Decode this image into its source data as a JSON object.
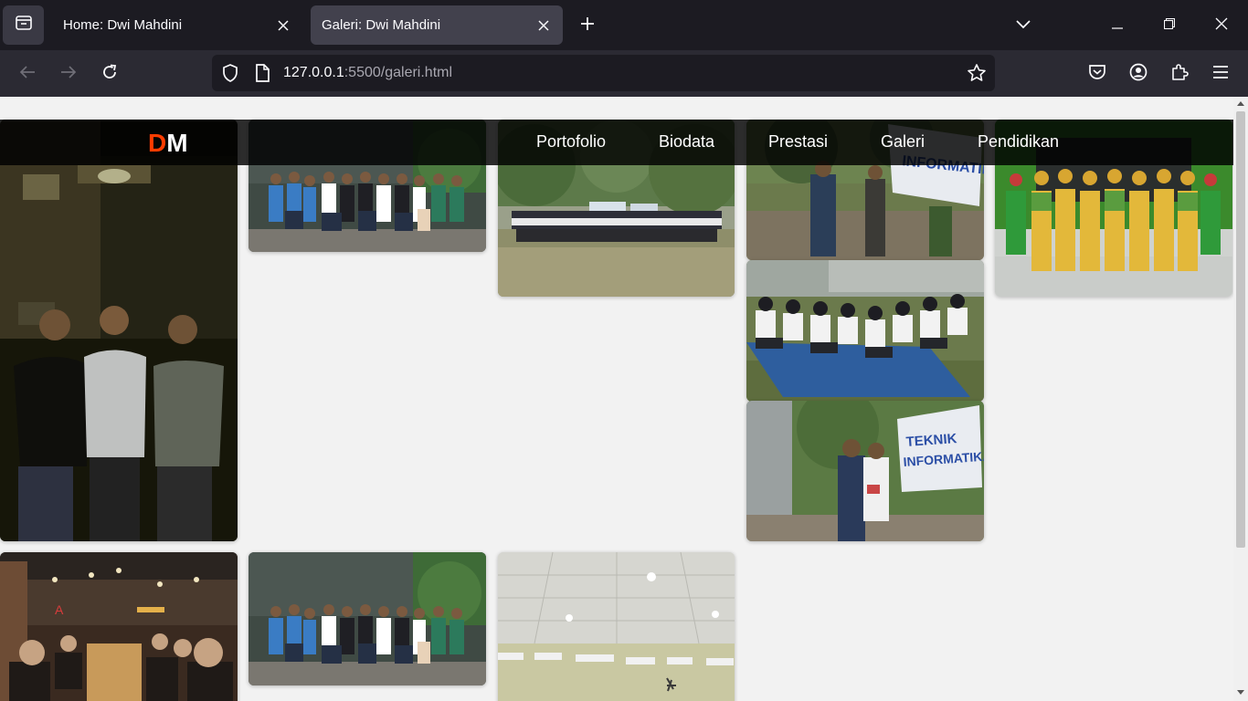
{
  "browser": {
    "tabs": [
      {
        "title": "Home: Dwi Mahdini",
        "active": false
      },
      {
        "title": "Galeri: Dwi Mahdini",
        "active": true
      }
    ],
    "url_host": "127.0.0.1",
    "url_path": ":5500/galeri.html",
    "icons": [
      "tab-list-icon",
      "close-icon",
      "plus-icon",
      "chevron-down-icon",
      "minimize-icon",
      "restore-icon",
      "window-close-icon",
      "back-icon",
      "forward-icon",
      "reload-icon",
      "shield-icon",
      "page-icon",
      "star-icon",
      "pocket-icon",
      "account-icon",
      "extensions-icon",
      "menu-icon"
    ]
  },
  "site": {
    "logo_d": "D",
    "logo_m": "M",
    "nav": [
      "Portofolio",
      "Biodata",
      "Prestasi",
      "Galeri",
      "Pendidikan"
    ],
    "colors": {
      "logo_accent": "#ff3c00",
      "header_bg": "#000000",
      "page_bg": "#f2f2f2"
    }
  },
  "gallery": {
    "photos": [
      {
        "subject": "three young men at night"
      },
      {
        "subject": "group photo of students in blue and green jackets"
      },
      {
        "subject": "large crowd in a field with banner"
      },
      {
        "subject": "speaker with megaphone and Teknik Informatika banner"
      },
      {
        "subject": "dancers in yellow traditional costume"
      },
      {
        "subject": "students seated on the ground"
      },
      {
        "subject": "speaker with Teknik Informatika banner"
      },
      {
        "subject": "group at a restaurant"
      },
      {
        "subject": "group photo of students in blue and green jackets"
      },
      {
        "subject": "hall ceiling with lights"
      }
    ]
  }
}
